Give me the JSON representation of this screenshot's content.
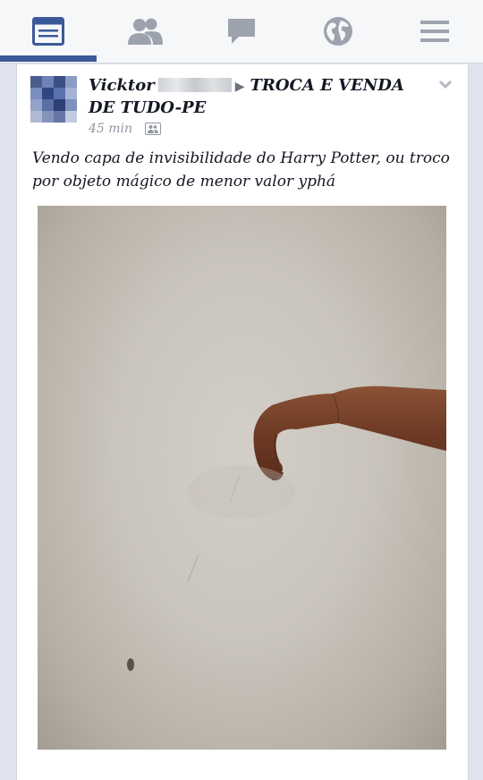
{
  "nav": {
    "tabs": [
      {
        "icon": "news-feed-icon",
        "active": true
      },
      {
        "icon": "friends-icon",
        "active": false
      },
      {
        "icon": "messages-icon",
        "active": false
      },
      {
        "icon": "globe-icon",
        "active": false
      },
      {
        "icon": "menu-icon",
        "active": false
      }
    ],
    "accent": "#3b5998"
  },
  "post": {
    "author": "Vicktor",
    "separator": "▶",
    "group": "TROCA E VENDA DE TUDO-PE",
    "time": "45 min",
    "privacy_icon": "group-audience-icon",
    "text": "Vendo capa de invisibilidade do Harry Potter, ou troco por objeto mágico de menor valor yphá",
    "options_icon": "chevron-down-icon"
  }
}
